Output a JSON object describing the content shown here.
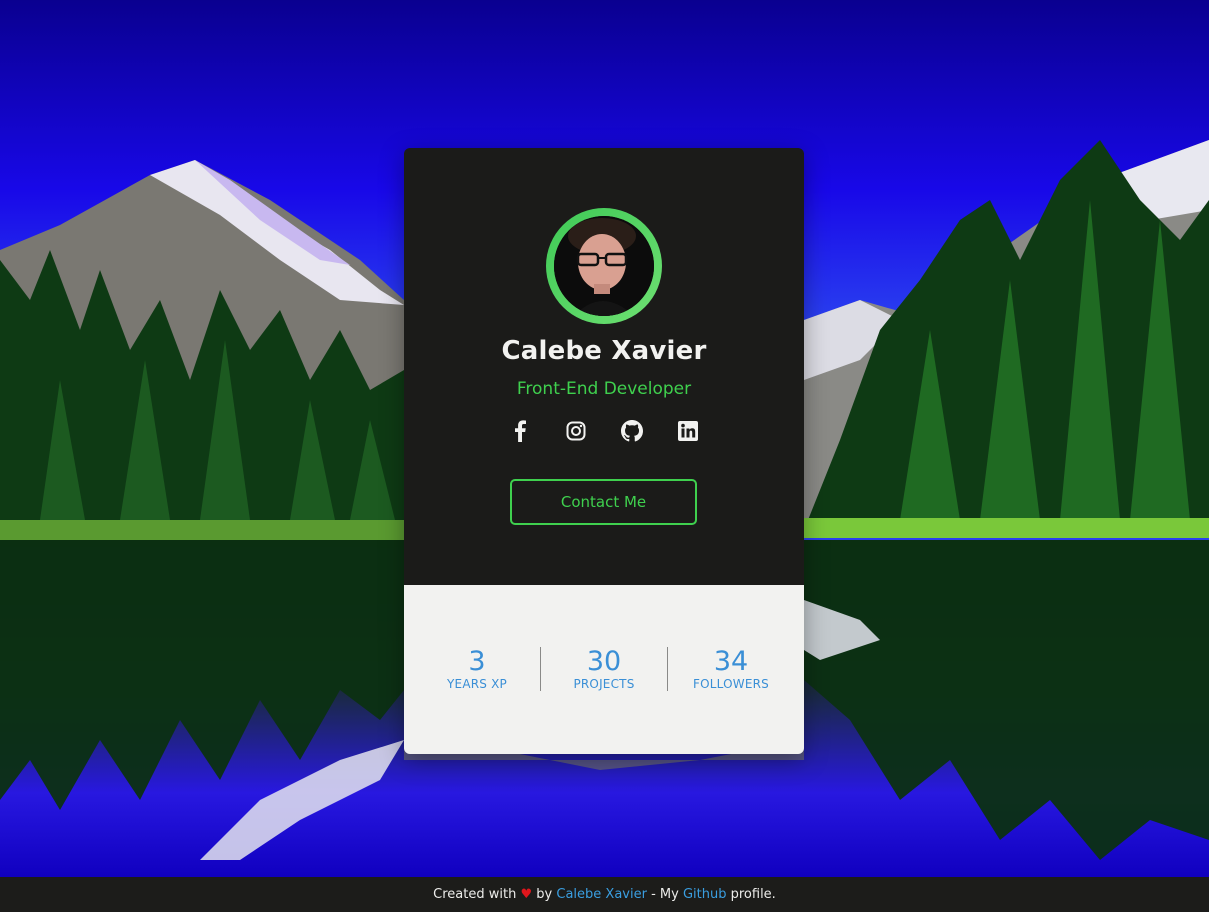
{
  "profile": {
    "name": "Calebe Xavier",
    "role": "Front-End Developer",
    "contact_label": "Contact Me"
  },
  "socials": [
    {
      "icon": "facebook-icon"
    },
    {
      "icon": "instagram-icon"
    },
    {
      "icon": "github-icon"
    },
    {
      "icon": "linkedin-icon"
    }
  ],
  "stats": [
    {
      "value": "3",
      "label": "YEARS XP"
    },
    {
      "value": "30",
      "label": "PROJECTS"
    },
    {
      "value": "34",
      "label": "FOLLOWERS"
    }
  ],
  "footer": {
    "prefix": "Created with",
    "heart": "♥",
    "by": "by",
    "author_link": "Calebe Xavier",
    "middle": "- My",
    "github_link": "Github",
    "suffix": "profile."
  },
  "colors": {
    "accent_green": "#3fd04e",
    "stat_blue": "#3a8fd6",
    "card_dark": "#1b1b19",
    "card_light": "#f2f2f0",
    "link_blue": "#3a9ee0",
    "heart_red": "#e0161c"
  }
}
